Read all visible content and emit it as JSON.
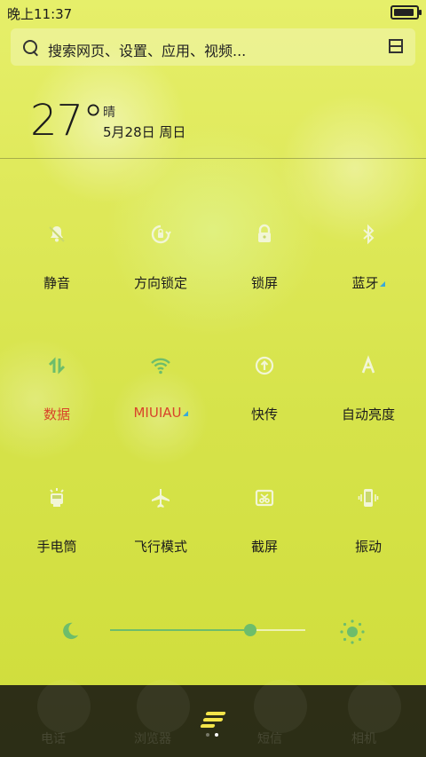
{
  "status_bar": {
    "time": "晚上11:37"
  },
  "search": {
    "placeholder": "搜索网页、设置、应用、视频..."
  },
  "weather": {
    "temperature": "27°",
    "condition": "晴",
    "date": "5月28日 周日"
  },
  "toggles": [
    {
      "label": "静音",
      "icon": "mute-bell-icon",
      "active": false
    },
    {
      "label": "方向锁定",
      "icon": "rotation-lock-icon",
      "active": false
    },
    {
      "label": "锁屏",
      "icon": "lock-icon",
      "active": false
    },
    {
      "label": "蓝牙",
      "icon": "bluetooth-icon",
      "active": false,
      "has_more": true
    },
    {
      "label": "数据",
      "icon": "data-arrows-icon",
      "active": true
    },
    {
      "label": "MIUIAU",
      "icon": "wifi-icon",
      "active": true,
      "has_more": true
    },
    {
      "label": "快传",
      "icon": "fast-transfer-icon",
      "active": false
    },
    {
      "label": "自动亮度",
      "icon": "auto-brightness-icon",
      "active": false
    },
    {
      "label": "手电筒",
      "icon": "flashlight-icon",
      "active": false
    },
    {
      "label": "飞行模式",
      "icon": "airplane-icon",
      "active": false
    },
    {
      "label": "截屏",
      "icon": "screenshot-icon",
      "active": false
    },
    {
      "label": "振动",
      "icon": "vibrate-icon",
      "active": false
    }
  ],
  "brightness": {
    "level": 0.72,
    "min_icon": "moon-icon",
    "max_icon": "sun-icon"
  },
  "dock": {
    "apps": [
      {
        "label": "电话",
        "icon": "phone-icon"
      },
      {
        "label": "浏览器",
        "icon": "browser-icon"
      },
      {
        "label": "短信",
        "icon": "messages-icon"
      },
      {
        "label": "相机",
        "icon": "camera-icon"
      }
    ],
    "page_count": 2,
    "current_page": 2
  },
  "colors": {
    "accent_green": "#6dbd6b",
    "active_label": "#d8442a",
    "handle_yellow": "#f4e54a"
  }
}
